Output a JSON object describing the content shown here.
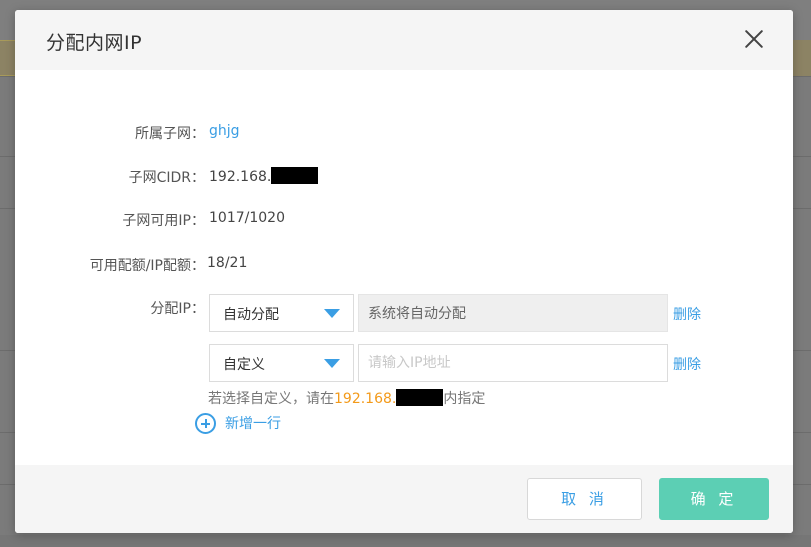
{
  "dialog": {
    "title": "分配内网IP"
  },
  "info": {
    "subnet_label": "所属子网：",
    "subnet_value": "ghjg",
    "cidr_label": "子网CIDR：",
    "cidr_value": "192.168.",
    "available_ip_label": "子网可用IP：",
    "available_ip_value": "1017/1020",
    "quota_label": "可用配额/IP配额：",
    "quota_value": "18/21"
  },
  "assign": {
    "label": "分配IP：",
    "rows": [
      {
        "mode": "自动分配",
        "input_value": "系统将自动分配",
        "input_placeholder": "",
        "delete_label": "删除"
      },
      {
        "mode": "自定义",
        "input_value": "",
        "input_placeholder": "请输入IP地址",
        "delete_label": "删除"
      }
    ],
    "hint_prefix": "若选择自定义，请在",
    "hint_ip": "192.168.",
    "hint_suffix": "内指定",
    "add_row_label": "新增一行"
  },
  "footer": {
    "cancel_label": "取 消",
    "ok_label": "确 定"
  },
  "colors": {
    "accent": "#3a9ee4",
    "ok": "#5ccfb4",
    "hint_ip": "#f39a1a"
  },
  "icons": {
    "close": "close-icon",
    "add": "plus-circle-icon",
    "dropdown": "caret-down-icon"
  }
}
